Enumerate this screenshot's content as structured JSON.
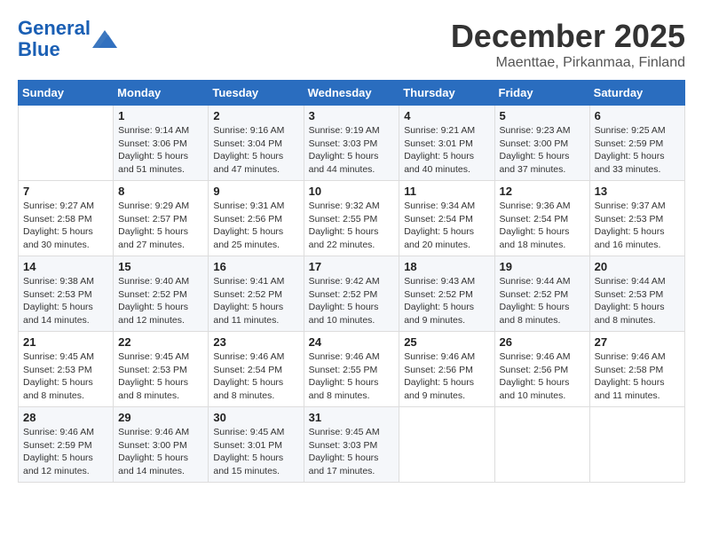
{
  "logo": {
    "line1": "General",
    "line2": "Blue"
  },
  "title": "December 2025",
  "subtitle": "Maenttae, Pirkanmaa, Finland",
  "days_header": [
    "Sunday",
    "Monday",
    "Tuesday",
    "Wednesday",
    "Thursday",
    "Friday",
    "Saturday"
  ],
  "weeks": [
    [
      {
        "num": "",
        "info": ""
      },
      {
        "num": "1",
        "info": "Sunrise: 9:14 AM\nSunset: 3:06 PM\nDaylight: 5 hours\nand 51 minutes."
      },
      {
        "num": "2",
        "info": "Sunrise: 9:16 AM\nSunset: 3:04 PM\nDaylight: 5 hours\nand 47 minutes."
      },
      {
        "num": "3",
        "info": "Sunrise: 9:19 AM\nSunset: 3:03 PM\nDaylight: 5 hours\nand 44 minutes."
      },
      {
        "num": "4",
        "info": "Sunrise: 9:21 AM\nSunset: 3:01 PM\nDaylight: 5 hours\nand 40 minutes."
      },
      {
        "num": "5",
        "info": "Sunrise: 9:23 AM\nSunset: 3:00 PM\nDaylight: 5 hours\nand 37 minutes."
      },
      {
        "num": "6",
        "info": "Sunrise: 9:25 AM\nSunset: 2:59 PM\nDaylight: 5 hours\nand 33 minutes."
      }
    ],
    [
      {
        "num": "7",
        "info": "Sunrise: 9:27 AM\nSunset: 2:58 PM\nDaylight: 5 hours\nand 30 minutes."
      },
      {
        "num": "8",
        "info": "Sunrise: 9:29 AM\nSunset: 2:57 PM\nDaylight: 5 hours\nand 27 minutes."
      },
      {
        "num": "9",
        "info": "Sunrise: 9:31 AM\nSunset: 2:56 PM\nDaylight: 5 hours\nand 25 minutes."
      },
      {
        "num": "10",
        "info": "Sunrise: 9:32 AM\nSunset: 2:55 PM\nDaylight: 5 hours\nand 22 minutes."
      },
      {
        "num": "11",
        "info": "Sunrise: 9:34 AM\nSunset: 2:54 PM\nDaylight: 5 hours\nand 20 minutes."
      },
      {
        "num": "12",
        "info": "Sunrise: 9:36 AM\nSunset: 2:54 PM\nDaylight: 5 hours\nand 18 minutes."
      },
      {
        "num": "13",
        "info": "Sunrise: 9:37 AM\nSunset: 2:53 PM\nDaylight: 5 hours\nand 16 minutes."
      }
    ],
    [
      {
        "num": "14",
        "info": "Sunrise: 9:38 AM\nSunset: 2:53 PM\nDaylight: 5 hours\nand 14 minutes."
      },
      {
        "num": "15",
        "info": "Sunrise: 9:40 AM\nSunset: 2:52 PM\nDaylight: 5 hours\nand 12 minutes."
      },
      {
        "num": "16",
        "info": "Sunrise: 9:41 AM\nSunset: 2:52 PM\nDaylight: 5 hours\nand 11 minutes."
      },
      {
        "num": "17",
        "info": "Sunrise: 9:42 AM\nSunset: 2:52 PM\nDaylight: 5 hours\nand 10 minutes."
      },
      {
        "num": "18",
        "info": "Sunrise: 9:43 AM\nSunset: 2:52 PM\nDaylight: 5 hours\nand 9 minutes."
      },
      {
        "num": "19",
        "info": "Sunrise: 9:44 AM\nSunset: 2:52 PM\nDaylight: 5 hours\nand 8 minutes."
      },
      {
        "num": "20",
        "info": "Sunrise: 9:44 AM\nSunset: 2:53 PM\nDaylight: 5 hours\nand 8 minutes."
      }
    ],
    [
      {
        "num": "21",
        "info": "Sunrise: 9:45 AM\nSunset: 2:53 PM\nDaylight: 5 hours\nand 8 minutes."
      },
      {
        "num": "22",
        "info": "Sunrise: 9:45 AM\nSunset: 2:53 PM\nDaylight: 5 hours\nand 8 minutes."
      },
      {
        "num": "23",
        "info": "Sunrise: 9:46 AM\nSunset: 2:54 PM\nDaylight: 5 hours\nand 8 minutes."
      },
      {
        "num": "24",
        "info": "Sunrise: 9:46 AM\nSunset: 2:55 PM\nDaylight: 5 hours\nand 8 minutes."
      },
      {
        "num": "25",
        "info": "Sunrise: 9:46 AM\nSunset: 2:56 PM\nDaylight: 5 hours\nand 9 minutes."
      },
      {
        "num": "26",
        "info": "Sunrise: 9:46 AM\nSunset: 2:56 PM\nDaylight: 5 hours\nand 10 minutes."
      },
      {
        "num": "27",
        "info": "Sunrise: 9:46 AM\nSunset: 2:58 PM\nDaylight: 5 hours\nand 11 minutes."
      }
    ],
    [
      {
        "num": "28",
        "info": "Sunrise: 9:46 AM\nSunset: 2:59 PM\nDaylight: 5 hours\nand 12 minutes."
      },
      {
        "num": "29",
        "info": "Sunrise: 9:46 AM\nSunset: 3:00 PM\nDaylight: 5 hours\nand 14 minutes."
      },
      {
        "num": "30",
        "info": "Sunrise: 9:45 AM\nSunset: 3:01 PM\nDaylight: 5 hours\nand 15 minutes."
      },
      {
        "num": "31",
        "info": "Sunrise: 9:45 AM\nSunset: 3:03 PM\nDaylight: 5 hours\nand 17 minutes."
      },
      {
        "num": "",
        "info": ""
      },
      {
        "num": "",
        "info": ""
      },
      {
        "num": "",
        "info": ""
      }
    ]
  ]
}
